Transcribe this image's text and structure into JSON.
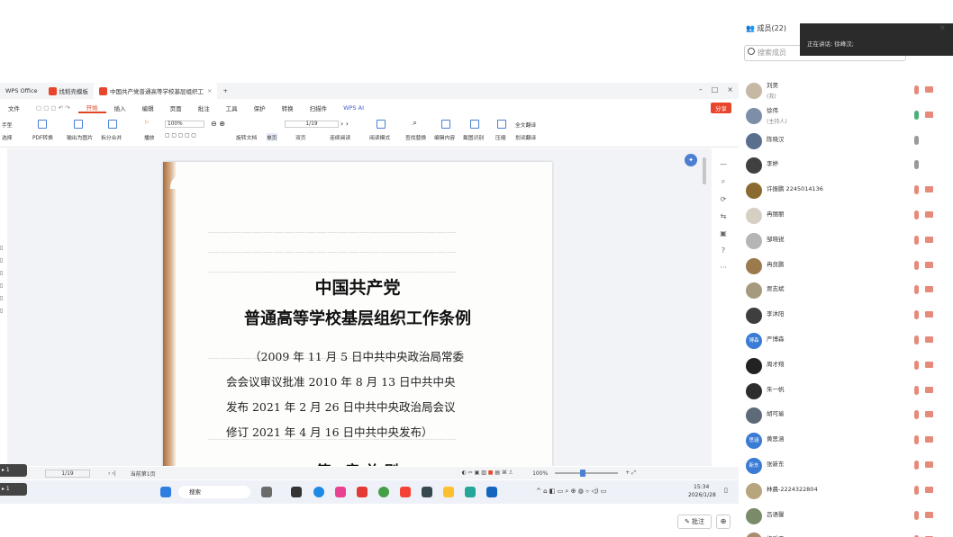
{
  "wps": {
    "tabs": [
      {
        "label": "WPS Office"
      },
      {
        "label": "找稻壳模板"
      },
      {
        "label": "中国共产党普通高等学校基层组织工"
      }
    ],
    "add_tab": "+",
    "menu": [
      "文件",
      "开始",
      "插入",
      "编辑",
      "页面",
      "批注",
      "工具",
      "保护",
      "转换",
      "扫描件",
      "WPS AI"
    ],
    "share": "分享",
    "toolbar": {
      "hand": "手型",
      "select": "选择",
      "pdf_convert": "PDF转换",
      "to_image": "输出为图片",
      "split_merge": "拆分合并",
      "play": "播放",
      "zoom": "100%",
      "page_input": "1/19",
      "rotate": "旋转文档",
      "single": "单页",
      "double": "双页",
      "continuous": "连续阅读",
      "read_mode": "阅读模式",
      "find_replace": "查找替换",
      "edit_content": "编辑内容",
      "screenshot": "截图识别",
      "compress": "压缩",
      "translate": "全文翻译",
      "auto_scroll": "划词翻译"
    },
    "statusbar": {
      "page": "1/19",
      "note": "当前第1页",
      "zoom": "100%"
    }
  },
  "document": {
    "title_line1": "中国共产党",
    "title_line2": "普通高等学校基层组织工作条例",
    "sub_lines": [
      "（2009 年 11 月 5 日中共中央政治局常委",
      "会会议审议批准    2010 年 8 月 13 日中共中央",
      "发布    2021 年 2 月 26 日中共中央政治局会议",
      "修订    2021 年 4 月 16 日中共中央发布）"
    ],
    "chapter": "第一章    总    则"
  },
  "taskbar": {
    "search": "搜索",
    "time": "15:34",
    "date": "2026/1/28"
  },
  "meeting": {
    "members_title": "成员(22)",
    "search_placeholder": "搜索成员",
    "speaking_label": "正在讲话:  徐峰汉;",
    "members": [
      {
        "name": "刘昊",
        "role": "(我)",
        "color": "#c7b8a6",
        "mic": "red"
      },
      {
        "name": "徐伟",
        "role": "(主持人)",
        "color": "#7d8fa8",
        "mic": "ok"
      },
      {
        "name": "陈晓汉",
        "role": "",
        "color": "#5a6f8e",
        "mic": "gray"
      },
      {
        "name": "李婷",
        "role": "",
        "color": "#404040",
        "mic": "gray"
      },
      {
        "name": "许振鹏 2245014136",
        "role": "",
        "color": "#8a6a2e",
        "mic": "red"
      },
      {
        "name": "冉丽丽",
        "role": "",
        "color": "#d6cfc4",
        "mic": "red"
      },
      {
        "name": "邹晓锐",
        "role": "",
        "color": "#b5b5b5",
        "mic": "red"
      },
      {
        "name": "冉良鹏",
        "role": "",
        "color": "#9b7a4e",
        "mic": "red"
      },
      {
        "name": "贾志斌",
        "role": "",
        "color": "#a69a7e",
        "mic": "red"
      },
      {
        "name": "李沐阳",
        "role": "",
        "color": "#3e3e3e",
        "mic": "red"
      },
      {
        "name": "严博森",
        "role": "",
        "color": "#3a7bd5",
        "avatar_text": "博森",
        "mic": "red"
      },
      {
        "name": "周才翔",
        "role": "",
        "color": "#222222",
        "mic": "red"
      },
      {
        "name": "朱一帆",
        "role": "",
        "color": "#2d2d2d",
        "mic": "red"
      },
      {
        "name": "胡可瑜",
        "role": "",
        "color": "#5e6a78",
        "mic": "red"
      },
      {
        "name": "黄思涵",
        "role": "",
        "color": "#3a7bd5",
        "avatar_text": "思涵",
        "mic": "red"
      },
      {
        "name": "张新东",
        "role": "",
        "color": "#3a7bd5",
        "avatar_text": "新东",
        "mic": "red"
      },
      {
        "name": "林晨-2224322804",
        "role": "",
        "color": "#b7a67d",
        "mic": "red"
      },
      {
        "name": "吕语馨",
        "role": "",
        "color": "#7a8b6a",
        "mic": "red"
      },
      {
        "name": "梅乐天",
        "role": "",
        "color": "#a88c6e",
        "mic": "red"
      }
    ]
  },
  "buttons": {
    "annotate": "批注",
    "zoom": "⊕"
  }
}
